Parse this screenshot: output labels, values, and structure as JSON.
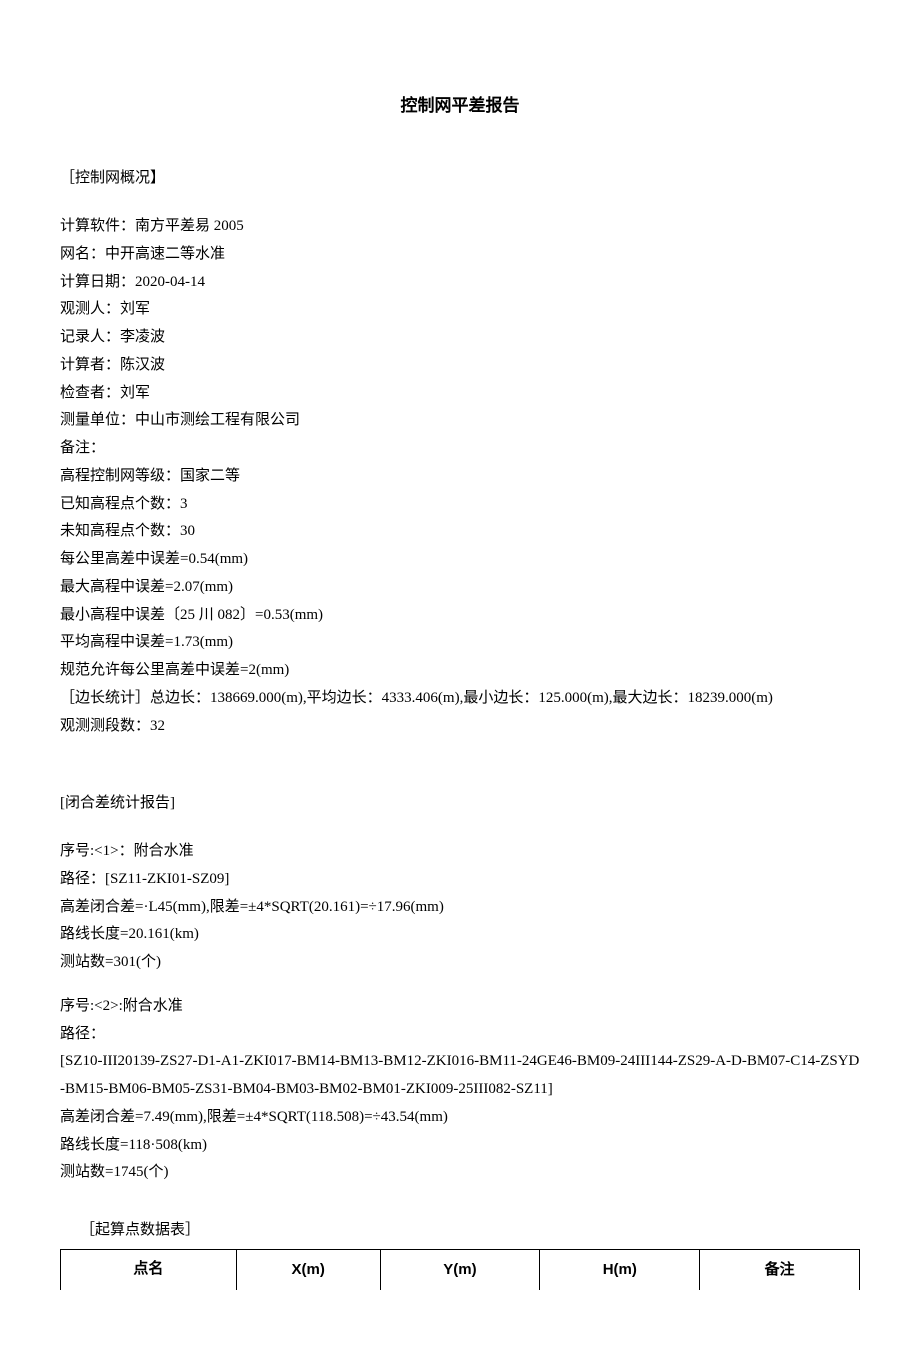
{
  "title": "控制网平差报告",
  "section1": {
    "heading": "［控制网概况】",
    "lines": [
      "计算软件：南方平差易 2005",
      "网名：中开高速二等水准",
      "计算日期：2020-04-14",
      "观测人：刘军",
      "记录人：李凌波",
      "计算者：陈汉波",
      "检查者：刘军",
      "测量单位：中山市测绘工程有限公司",
      "备注：",
      "高程控制网等级：国家二等",
      "已知高程点个数：3",
      "未知高程点个数：30",
      "每公里高差中误差=0.54(mm)",
      "最大高程中误差=2.07(mm)",
      "最小高程中误差〔25 川 082〕=0.53(mm)",
      "平均高程中误差=1.73(mm)",
      "规范允许每公里高差中误差=2(mm)",
      "［边长统计］总边长：138669.000(m),平均边长：4333.406(m),最小边长：125.000(m),最大边长：18239.000(m)",
      "观测测段数：32"
    ]
  },
  "section2": {
    "heading": "[闭合差统计报告]",
    "group1": [
      "序号:<1>：附合水准",
      "路径：[SZ11-ZKI01-SZ09]",
      "高差闭合差=·L45(mm),限差=±4*SQRT(20.161)=÷17.96(mm)",
      "路线长度=20.161(km)",
      "测站数=301(个)"
    ],
    "group2": [
      "序号:<2>:附合水准",
      "路径：",
      "[SZ10-III20139-ZS27-D1-A1-ZKI017-BM14-BM13-BM12-ZKI016-BM11-24GE46-BM09-24III144-ZS29-A-D-BM07-C14-ZSYD-BM15-BM06-BM05-ZS31-BM04-BM03-BM02-BM01-ZKI009-25III082-SZ11]",
      "高差闭合差=7.49(mm),限差=±4*SQRT(118.508)=÷43.54(mm)",
      "路线长度=118·508(km)",
      "测站数=1745(个)"
    ]
  },
  "section3": {
    "heading": "［起算点数据表］",
    "table": {
      "headers": [
        "点名",
        "X(m)",
        "Y(m)",
        "H(m)",
        "备注"
      ]
    }
  }
}
